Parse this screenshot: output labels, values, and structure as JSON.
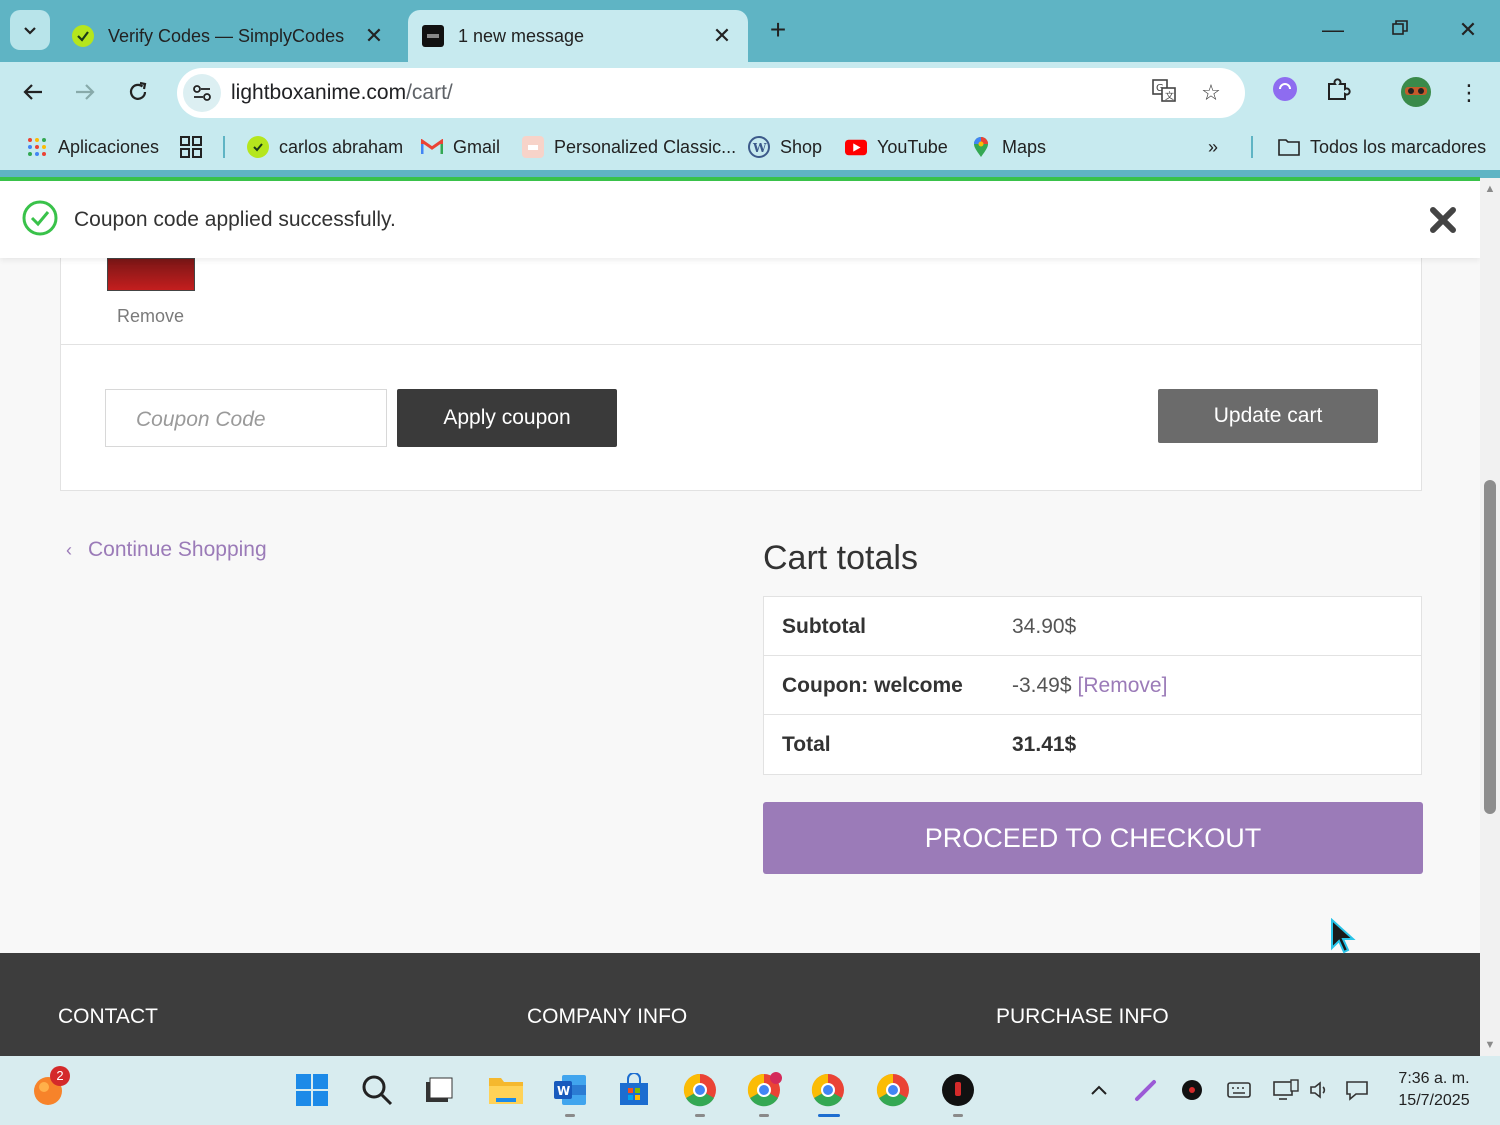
{
  "browser": {
    "tabs": [
      {
        "title": "Verify Codes — SimplyCodes",
        "icon": "simplycodes-icon",
        "active": false
      },
      {
        "title": "1 new message",
        "icon": "lightbox-icon",
        "active": true
      }
    ],
    "url": {
      "domain": "lightboxanime.com",
      "path": "/cart/"
    },
    "bookmarks": [
      {
        "label": "Aplicaciones",
        "icon": "apps-grid-icon"
      },
      {
        "label": "carlos abraham",
        "icon": "simplycodes-icon"
      },
      {
        "label": "Gmail",
        "icon": "gmail-icon"
      },
      {
        "label": "Personalized Classic...",
        "icon": "bookmark-favicon-icon"
      },
      {
        "label": "Shop",
        "icon": "wordpress-icon"
      },
      {
        "label": "YouTube",
        "icon": "youtube-icon"
      },
      {
        "label": "Maps",
        "icon": "maps-pin-icon"
      }
    ],
    "all_bookmarks": "Todos los marcadores"
  },
  "notice": {
    "text": "Coupon code applied successfully."
  },
  "cart": {
    "remove_label": "Remove",
    "coupon_placeholder": "Coupon Code",
    "apply_label": "Apply coupon",
    "update_label": "Update cart"
  },
  "continue_label": "Continue Shopping",
  "totals": {
    "title": "Cart totals",
    "rows": [
      {
        "label": "Subtotal",
        "value": "34.90$"
      },
      {
        "label": "Coupon: welcome",
        "value": "-3.49$",
        "link": "[Remove]"
      },
      {
        "label": "Total",
        "value": "31.41$"
      }
    ],
    "checkout_label": "PROCEED TO CHECKOUT"
  },
  "footer": {
    "headings": [
      "CONTACT",
      "COMPANY INFO",
      "PURCHASE INFO"
    ]
  },
  "taskbar": {
    "notification_count": "2",
    "time": "7:36 a. m.",
    "date": "15/7/2025"
  },
  "colors": {
    "accent": "#9b7bb8",
    "success": "#39c24a",
    "footer": "#3d3d3d",
    "chrome": "#5fb4c4"
  }
}
